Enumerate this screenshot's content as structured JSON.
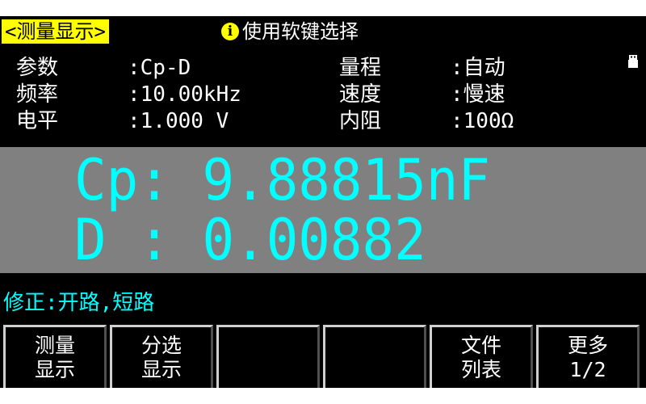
{
  "header": {
    "title_tab": "<测量显示>",
    "hint_icon": "info-icon",
    "hint_text": "使用软键选择",
    "status_icon": "usb-icon"
  },
  "params_left": [
    {
      "label": "参数",
      "value": ":Cp-D"
    },
    {
      "label": "频率",
      "value": ":10.00kHz"
    },
    {
      "label": "电平",
      "value": ":1.000 V"
    }
  ],
  "params_right": [
    {
      "label": "量程",
      "value": ":自动"
    },
    {
      "label": "速度",
      "value": ":慢速"
    },
    {
      "label": "内阻",
      "value": ":100Ω"
    }
  ],
  "measurement": {
    "primary": "Cp: 9.88815nF",
    "secondary": "D : 0.00882"
  },
  "correction": "修正:开路,短路",
  "softkeys": [
    {
      "line1": "测量",
      "line2": "显示"
    },
    {
      "line1": "分选",
      "line2": "显示"
    },
    {
      "line1": "",
      "line2": ""
    },
    {
      "line1": "",
      "line2": ""
    },
    {
      "line1": "文件",
      "line2": "列表"
    },
    {
      "line1": "更多",
      "line2": "1/2"
    }
  ],
  "colors": {
    "background": "#000000",
    "highlight": "#ffff00",
    "measurement_text": "#00ffff",
    "measurement_panel": "#808080",
    "text": "#ffffff"
  }
}
